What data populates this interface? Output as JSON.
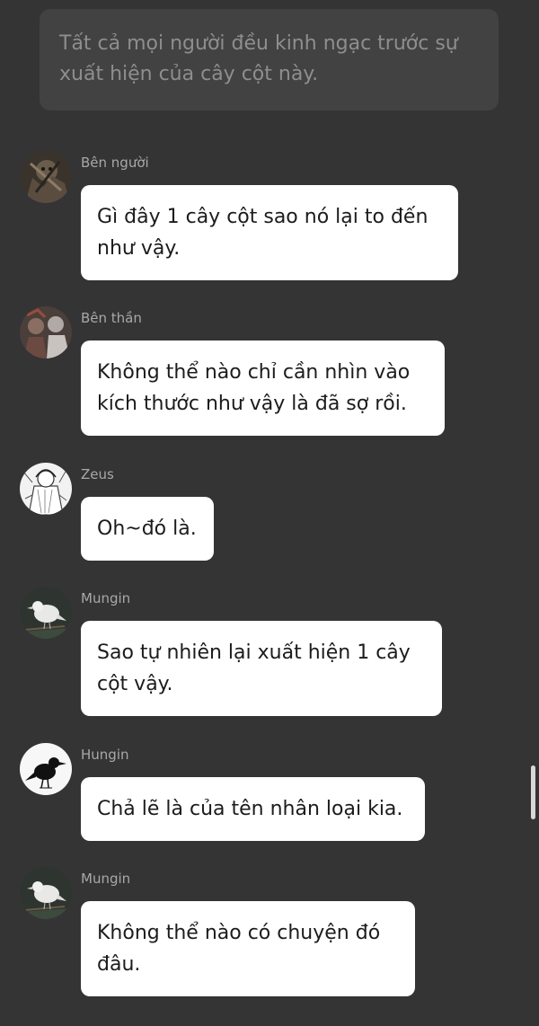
{
  "narration": {
    "text": "Tất cả mọi người đều kinh ngạc trước sự xuất hiện của cây cột này."
  },
  "messages": [
    {
      "sender": "Bên người",
      "text": "Gì đây 1 cây cột sao nó lại to đến như vậy.",
      "avatar_icon": "human-side-avatar-icon"
    },
    {
      "sender": "Bên thần",
      "text": "Không thể nào chỉ cần nhìn vào kích thước như vậy là đã sợ rồi.",
      "avatar_icon": "god-side-avatar-icon"
    },
    {
      "sender": "Zeus",
      "text": "Oh~đó là.",
      "avatar_icon": "zeus-avatar-icon"
    },
    {
      "sender": "Mungin",
      "text": "Sao tự nhiên lại xuất hiện 1 cây cột vậy.",
      "avatar_icon": "white-raven-avatar-icon"
    },
    {
      "sender": "Hungin",
      "text": "Chả lẽ là của tên nhân loại kia.",
      "avatar_icon": "black-crow-avatar-icon"
    },
    {
      "sender": "Mungin",
      "text": "Không thể nào có chuyện đó đâu.",
      "avatar_icon": "white-raven-avatar-icon"
    }
  ],
  "colors": {
    "background": "#343434",
    "narration_box": "#424242",
    "narration_text": "#8e8e8e",
    "bubble": "#ffffff",
    "bubble_text": "#1c1c1c",
    "sender_text": "#a8a8a8"
  }
}
